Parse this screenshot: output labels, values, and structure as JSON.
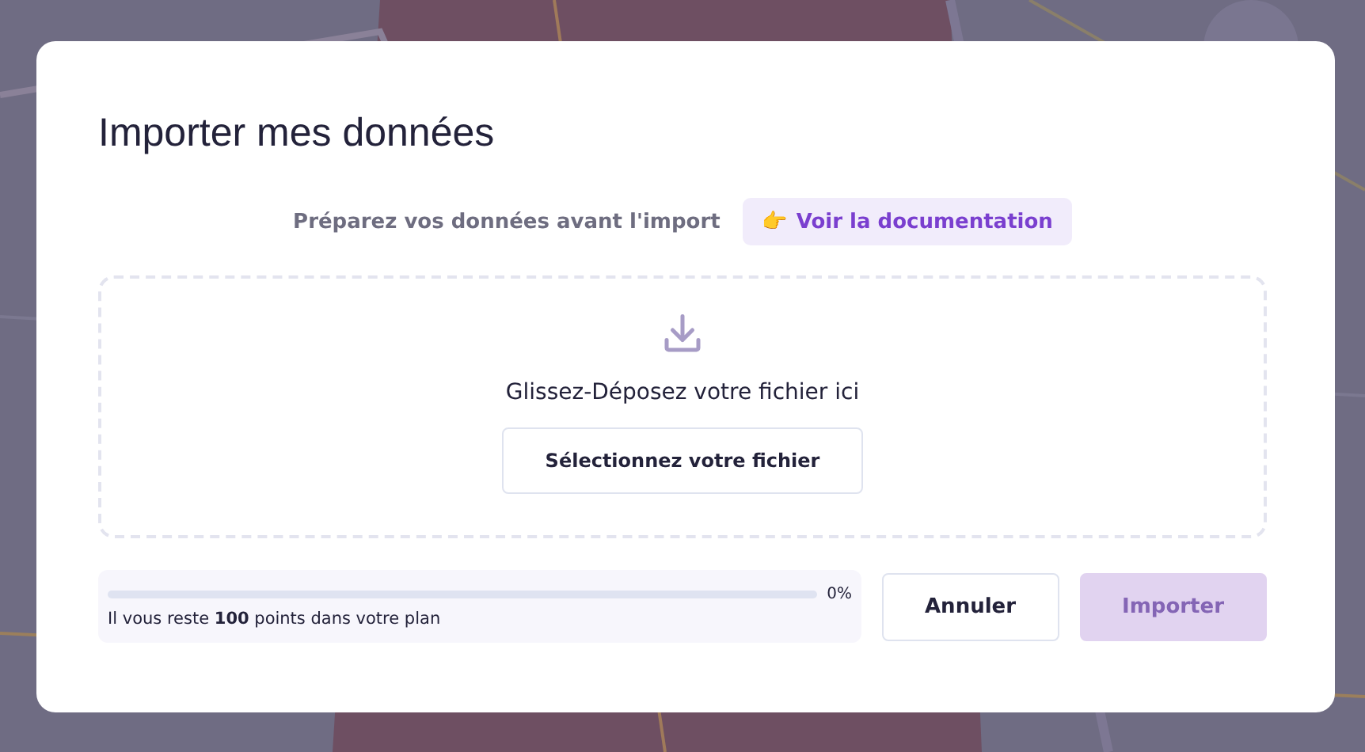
{
  "dialog": {
    "title": "Importer mes données",
    "hint": "Préparez vos données avant l'import",
    "doc_link": {
      "emoji": "👉",
      "label": "Voir la documentation"
    },
    "dropzone": {
      "text": "Glissez-Déposez votre fichier ici",
      "button": "Sélectionnez votre fichier"
    },
    "quota": {
      "level": 0,
      "reading": "0%",
      "text": "Il vous reste **100** points dans votre plan"
    },
    "buttons": [
      {
        "label": "Annuler",
        "kind": "secondary",
        "disabled": false
      },
      {
        "label": "Importer",
        "kind": "primary",
        "disabled": true
      }
    ]
  }
}
